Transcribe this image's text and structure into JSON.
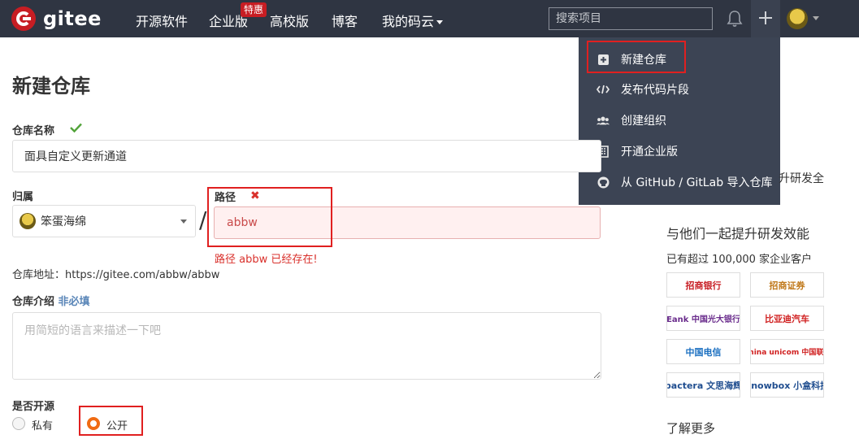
{
  "nav": {
    "logo": "gitee",
    "links": [
      "开源软件",
      "企业版",
      "高校版",
      "博客",
      "我的码云"
    ],
    "badge": "特惠",
    "search_placeholder": "搜索项目"
  },
  "dropdown": {
    "items": [
      {
        "label": "新建仓库",
        "icon": "plus-square-icon"
      },
      {
        "label": "发布代码片段",
        "icon": "code-icon"
      },
      {
        "label": "创建组织",
        "icon": "users-icon"
      },
      {
        "label": "开通企业版",
        "icon": "building-icon"
      },
      {
        "label": "从 GitHub / GitLab 导入仓库",
        "icon": "github-icon"
      }
    ]
  },
  "form": {
    "title": "新建仓库",
    "repo_name_label": "仓库名称",
    "repo_name_value": "面具自定义更新通道",
    "owner_label": "归属",
    "owner_value": "笨蛋海绵",
    "path_label": "路径",
    "path_value": "abbw",
    "path_error": "路径 abbw 已经存在!",
    "address": "仓库地址：https://gitee.com/abbw/abbw",
    "desc_label": "仓库介绍",
    "desc_optional": "非必填",
    "desc_placeholder": "用简短的语言来描述一下吧",
    "open_label": "是否开源",
    "private_label": "私有",
    "public_label": "公开"
  },
  "side": {
    "truncated": "升研发全",
    "heading": "与他们一起提升研发效能",
    "sub": "已有超过 100,000 家企业客户",
    "logos": [
      "招商银行",
      "招商证券",
      "Eank 中国光大银行",
      "比亚迪汽车",
      "中国电信",
      "China unicom 中国联通",
      "pactera 文思海辉",
      "knowbox 小盒科技"
    ],
    "more": "了解更多"
  },
  "colors": {
    "nav_bg": "#2f3542",
    "brand_red": "#c71d23",
    "error_red": "#d9312c",
    "accent_orange": "#f06b13",
    "check_green": "#52a33a"
  }
}
